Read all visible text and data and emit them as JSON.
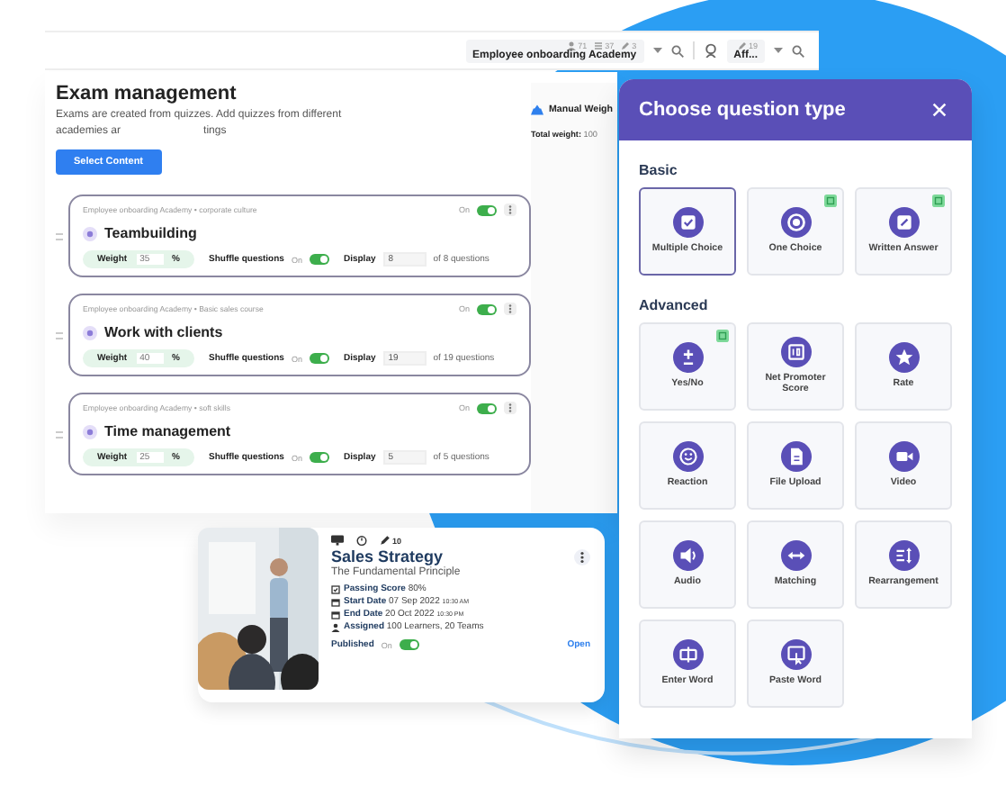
{
  "header": {
    "counts": [
      {
        "kind": "person",
        "value": "71"
      },
      {
        "kind": "list",
        "value": "37"
      },
      {
        "kind": "pencil",
        "value": "3"
      }
    ],
    "academy": "Employee onboarding Academy",
    "user_count": "19",
    "user": "Aff..."
  },
  "page": {
    "title": "Exam management",
    "description_lines": [
      [
        "Exams are created from quizzes. Add quizzes from different"
      ],
      [
        "academies ar",
        "tings"
      ]
    ],
    "button": "Select Content",
    "weight_mode": "Manual Weigh",
    "total_label": "Total weight:",
    "total_value": "100"
  },
  "quizzes": [
    {
      "path": "Employee onboarding Academy • corporate culture",
      "toggle_label": "On",
      "on": true,
      "title": "Teambuilding",
      "weight_label": "Weight",
      "weight": "35",
      "unit": "%",
      "shuffle_label": "Shuffle questions",
      "shuffle_state": "On",
      "shuffle_on": true,
      "display_label": "Display",
      "display": "8",
      "total": "of 8 questions"
    },
    {
      "path": "Employee onboarding Academy • Basic sales course",
      "toggle_label": "On",
      "on": true,
      "title": "Work with clients",
      "weight_label": "Weight",
      "weight": "40",
      "unit": "%",
      "shuffle_label": "Shuffle questions",
      "shuffle_state": "On",
      "shuffle_on": true,
      "display_label": "Display",
      "display": "19",
      "total": "of 19 questions"
    },
    {
      "path": "Employee onboarding Academy • soft skills",
      "toggle_label": "On",
      "on": true,
      "title": "Time management",
      "weight_label": "Weight",
      "weight": "25",
      "unit": "%",
      "shuffle_label": "Shuffle questions",
      "shuffle_state": "On",
      "shuffle_on": true,
      "display_label": "Display",
      "display": "5",
      "total": "of 5 questions"
    }
  ],
  "course_card": {
    "edit_count": "10",
    "title": "Sales Strategy",
    "subtitle": "The Fundamental Principle",
    "details": [
      {
        "kind": "score",
        "label": "Passing Score",
        "value": "80%"
      },
      {
        "kind": "calendar",
        "label": "Start Date",
        "value": "07 Sep 2022",
        "time": "10:30 AM"
      },
      {
        "kind": "calendar",
        "label": "End Date",
        "value": "20 Oct 2022",
        "time": "10:30 PM"
      },
      {
        "kind": "person",
        "label": "Assigned",
        "value": "100 Learners, 20 Teams"
      }
    ],
    "published_label": "Published",
    "published_state": "On",
    "published_on": true,
    "open": "Open"
  },
  "modal": {
    "title": "Choose question type",
    "sections": [
      {
        "title": "Basic",
        "types": [
          {
            "kind": "check",
            "label": "Multiple Choice",
            "selected": true,
            "new": false
          },
          {
            "kind": "radio",
            "label": "One Choice",
            "selected": false,
            "new": true
          },
          {
            "kind": "pencil",
            "label": "Written Answer",
            "selected": false,
            "new": true
          }
        ]
      },
      {
        "title": "Advanced",
        "types": [
          {
            "kind": "plusminus",
            "label": "Yes/No",
            "selected": false,
            "new": true
          },
          {
            "kind": "scale",
            "label": "Net Promoter Score",
            "selected": false,
            "new": false
          },
          {
            "kind": "star",
            "label": "Rate",
            "selected": false,
            "new": false
          },
          {
            "kind": "smile",
            "label": "Reaction",
            "selected": false,
            "new": false
          },
          {
            "kind": "file",
            "label": "File Upload",
            "selected": false,
            "new": false
          },
          {
            "kind": "video",
            "label": "Video",
            "selected": false,
            "new": false
          },
          {
            "kind": "audio",
            "label": "Audio",
            "selected": false,
            "new": false
          },
          {
            "kind": "arrows",
            "label": "Matching",
            "selected": false,
            "new": false
          },
          {
            "kind": "sort",
            "label": "Rearrangement",
            "selected": false,
            "new": false
          },
          {
            "kind": "enter",
            "label": "Enter Word",
            "selected": false,
            "new": false
          },
          {
            "kind": "paste",
            "label": "Paste Word",
            "selected": false,
            "new": false
          }
        ]
      }
    ]
  }
}
